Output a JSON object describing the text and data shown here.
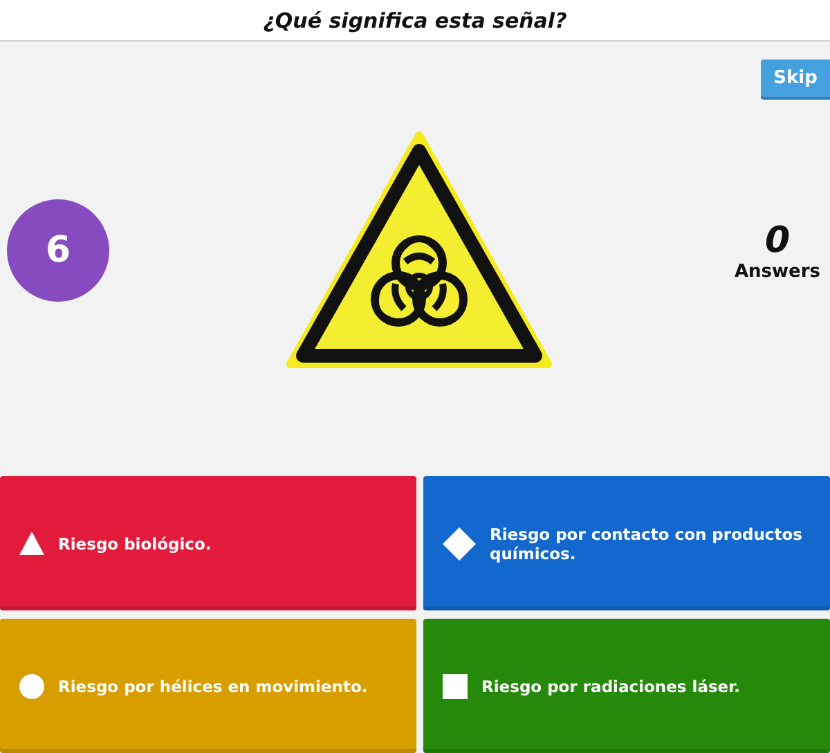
{
  "question": "¿Qué significa esta señal?",
  "skip_button": "Skip",
  "timer": "6",
  "answer_count": {
    "value": "0",
    "label": "Answers"
  },
  "answers": [
    {
      "kind": "triangle",
      "color": "#e21b3c",
      "text": "Riesgo biológico."
    },
    {
      "kind": "diamond",
      "color": "#1368ce",
      "text": "Riesgo por contacto con productos químicos."
    },
    {
      "kind": "circle",
      "color": "#d89e00",
      "text": "Riesgo por hélices en movimiento."
    },
    {
      "kind": "square",
      "color": "#26890c",
      "text": "Riesgo por radiaciones láser."
    }
  ]
}
